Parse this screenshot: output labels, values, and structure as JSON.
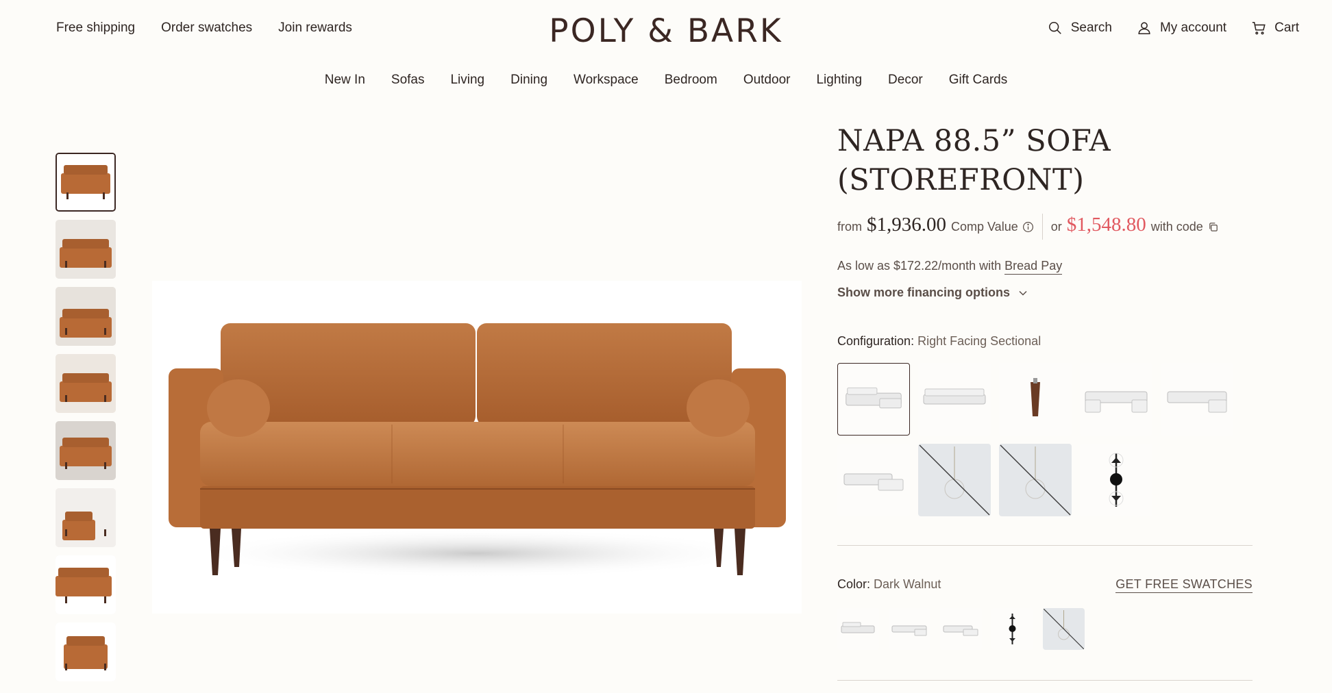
{
  "header": {
    "top_links": [
      "Free shipping",
      "Order swatches",
      "Join rewards"
    ],
    "logo": "POLY & BARK",
    "utility": {
      "search": "Search",
      "account": "My account",
      "cart": "Cart"
    },
    "nav": [
      "New In",
      "Sofas",
      "Living",
      "Dining",
      "Workspace",
      "Bedroom",
      "Outdoor",
      "Lighting",
      "Decor",
      "Gift Cards"
    ]
  },
  "product": {
    "title": "NAPA 88.5” SOFA (STOREFRONT)",
    "price_prefix": "from",
    "comp_price": "$1,936.00",
    "comp_label": "Comp Value",
    "or_label": "or",
    "sale_price": "$1,548.80",
    "with_code_label": "with code",
    "financing_text": "As low as $172.22/month with",
    "financing_link": "Bread Pay",
    "more_financing": "Show more financing options",
    "configuration_label": "Configuration:",
    "configuration_value": "Right Facing Sectional",
    "configuration_options": [
      {
        "icon": "sectional-sofa-icon",
        "selected": true
      },
      {
        "icon": "long-sofa-icon"
      },
      {
        "icon": "sofa-leg-icon"
      },
      {
        "icon": "u-sectional-icon"
      },
      {
        "icon": "l-sectional-icon"
      },
      {
        "icon": "chaise-sectional-icon"
      },
      {
        "icon": "pendant-lamp-icon",
        "unavailable": true
      },
      {
        "icon": "pendant-lamp-icon",
        "unavailable": true
      },
      {
        "icon": "wall-sconce-icon"
      }
    ],
    "color_label": "Color:",
    "color_value": "Dark Walnut",
    "swatches_link": "GET FREE SWATCHES",
    "color_options": [
      {
        "icon": "sectional-sofa-icon"
      },
      {
        "icon": "l-sectional-icon"
      },
      {
        "icon": "chaise-sectional-icon"
      },
      {
        "icon": "wall-sconce-icon"
      },
      {
        "icon": "pendant-lamp-icon",
        "unavailable": true
      }
    ]
  },
  "gallery": {
    "thumbnail_count": 8,
    "main_image": "tan-leather-sofa-image"
  },
  "colors": {
    "text": "#2e2522",
    "muted": "#5a4e48",
    "sale": "#e15960",
    "leather": "#b86a36",
    "background": "#fdfcf9"
  }
}
